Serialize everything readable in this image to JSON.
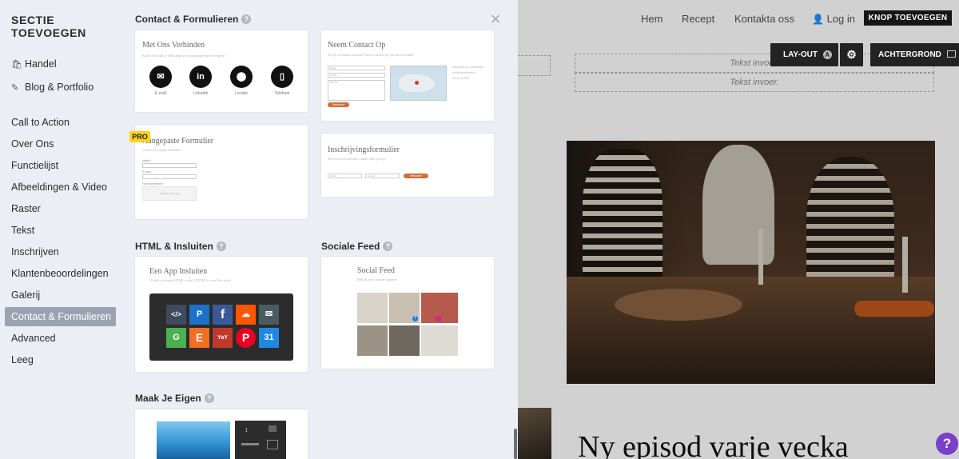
{
  "sidebar": {
    "title": "SECTIE TOEVOEGEN",
    "top_items": [
      {
        "label": "Handel",
        "icon": "shop-icon"
      },
      {
        "label": "Blog & Portfolio",
        "icon": "edit-icon"
      }
    ],
    "items": [
      "Call to Action",
      "Over Ons",
      "Functielijst",
      "Afbeeldingen & Video",
      "Raster",
      "Tekst",
      "Inschrijven",
      "Klantenbeoordelingen",
      "Galerij",
      "Contact & Formulieren",
      "Advanced",
      "Leeg"
    ],
    "active": "Contact & Formulieren"
  },
  "panel": {
    "categories": {
      "contact": "Contact & Formulieren",
      "html": "HTML & Insluiten",
      "social": "Sociale Feed",
      "own": "Maak Je Eigen"
    },
    "cards": {
      "connect": {
        "title": "Met Ons Verbinden",
        "subtitle": "Korte tekst dat je links naar je contactgegevens weergeeft",
        "icons": [
          {
            "label": "E-mail",
            "icon": "mail-icon"
          },
          {
            "label": "LinkedIn",
            "icon": "linkedin-icon"
          },
          {
            "label": "Locatie",
            "icon": "location-pin-icon"
          },
          {
            "label": "Telefoon",
            "icon": "phone-icon"
          }
        ]
      },
      "contact": {
        "title": "Neem Contact Op",
        "subtitle": "Wil je in contact komen? Neem contact op via het formulier",
        "fields": [
          "Naam",
          "E-mail",
          "Bericht"
        ],
        "button": "Versturen",
        "info": [
          "Wegvaart 34, Amsterdam",
          "info@voorbeeld.nl",
          "020 123 4567"
        ]
      },
      "custom_form": {
        "badge": "PRO",
        "title": "Aangepaste Formulier",
        "subtitle": "Creëer een uniek formulier",
        "fields": [
          "Naam *",
          "E-mail *",
          "Formulierbericht *"
        ],
        "button": "Bericht verzenden"
      },
      "signup": {
        "title": "Inschrijvingsformulier",
        "subtitle": "We versturen inhoud contact met jou op",
        "fields": [
          "Naam",
          "E-mail"
        ],
        "button": "Versturen"
      },
      "app_embed": {
        "title": "Een App Insluiten",
        "subtitle": "Of zelfs je eigen HTML-code! (HTML is voor Pro-abos)",
        "apps": [
          {
            "label": "</>",
            "color": "#3f4a5c"
          },
          {
            "label": "P",
            "color": "#1a73c8"
          },
          {
            "label": "f",
            "color": "#3b5998"
          },
          {
            "label": "☁",
            "color": "#ff5500"
          },
          {
            "label": "✉",
            "color": "#4b5b62"
          },
          {
            "label": "G",
            "color": "#4caf50"
          },
          {
            "label": "E",
            "color": "#f36e21"
          },
          {
            "label": "YaY",
            "color": "#c0392b"
          },
          {
            "label": "P",
            "color": "#e60023"
          },
          {
            "label": "31",
            "color": "#1e88e5"
          }
        ]
      },
      "social_feed": {
        "title": "Social Feed",
        "subtitle": "Bekijk onze laatste updates!",
        "tiles": [
          "#d9d3c9",
          "#c9bfb1",
          "#b65a4e",
          "#c2c0bb",
          "#9c9285",
          "#ded8d0",
          "#6e6860",
          "#8e8a82",
          "#dedad4"
        ]
      }
    }
  },
  "preview": {
    "nav": [
      "Hem",
      "Recept",
      "Kontakta oss"
    ],
    "login": "Log in",
    "nav_button": "KNOP TOEVOEGEN",
    "toolbar": {
      "layout": "LAY-OUT",
      "background": "ACHTERGROND"
    },
    "text_placeholder": "Tekst invoer.",
    "headline": "Ny episod varje vecka",
    "help": "?"
  }
}
